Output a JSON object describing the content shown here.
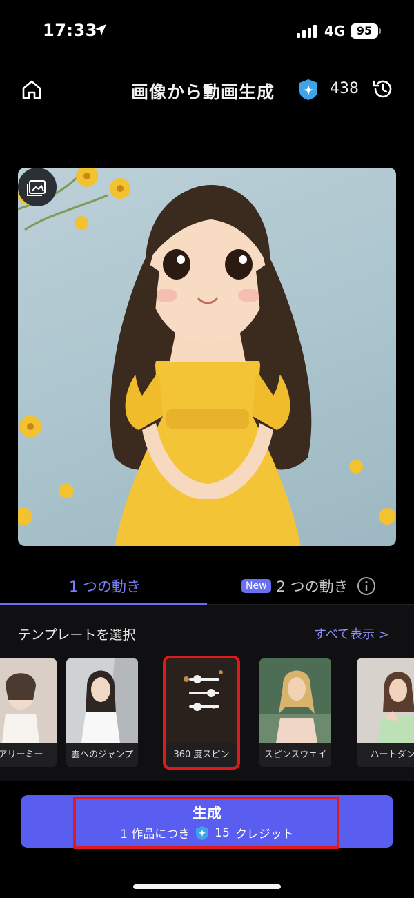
{
  "status_bar": {
    "time": "17:33",
    "network": "4G",
    "battery": "95"
  },
  "header": {
    "title": "画像から動画生成",
    "credits": "438",
    "credit_icon": "credit-gem-icon",
    "home_icon": "home-icon",
    "history_icon": "history-icon"
  },
  "hero": {
    "image_description_icon": "image-picker-icon"
  },
  "tabs": {
    "tab1_label": "1 つの動き",
    "tab2_badge": "New",
    "tab2_label": "2 つの動き"
  },
  "templates": {
    "section_title": "テンプレートを選択",
    "show_all": "すべて表示 >",
    "items": [
      {
        "label": "アリーミー"
      },
      {
        "label": "雲へのジャンプ"
      },
      {
        "label": "360 度スピン",
        "selected": true
      },
      {
        "label": "スピンスウェイ"
      },
      {
        "label": "ハートダン"
      }
    ]
  },
  "generate": {
    "title": "生成",
    "sub_prefix": "1 作品につき",
    "sub_credits": "15",
    "sub_suffix": "クレジット"
  },
  "colors": {
    "accent": "#5a5ef0",
    "tab_active": "#7a7cf5",
    "highlight_red": "#e01a1a"
  }
}
